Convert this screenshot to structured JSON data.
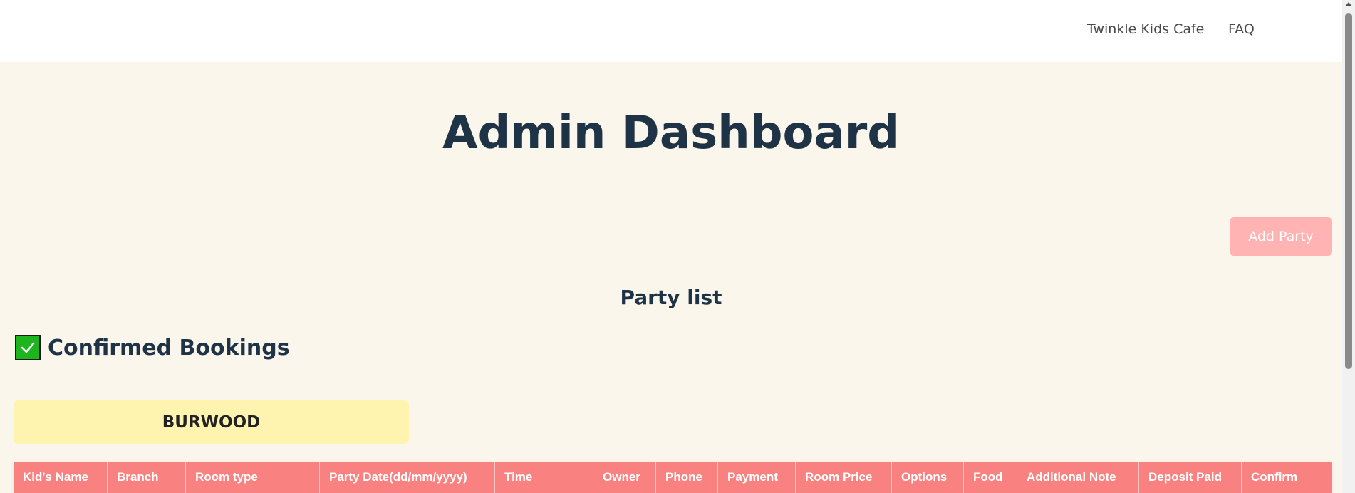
{
  "nav": {
    "brand": "Twinkle Kids Cafe",
    "faq": "FAQ"
  },
  "page": {
    "title": "Admin Dashboard",
    "add_party_label": "Add Party",
    "section_title": "Party list",
    "confirmed_heading": "Confirmed Bookings"
  },
  "branch": {
    "name": "BURWOOD"
  },
  "table": {
    "columns": [
      "Kid's Name",
      "Branch",
      "Room type",
      "Party Date(dd/mm/yyyy)",
      "Time",
      "Owner",
      "Phone",
      "Payment",
      "Room Price",
      "Options",
      "Food",
      "Additional Note",
      "Deposit Paid",
      "Confirm"
    ]
  },
  "colors": {
    "background": "#fbf6ec",
    "header_row": "#f98280",
    "add_party_button": "#ffb3b3",
    "branch_banner": "#fff3b0",
    "check_green": "#1db51d"
  },
  "icons": {
    "confirmed": "check-box-icon"
  }
}
